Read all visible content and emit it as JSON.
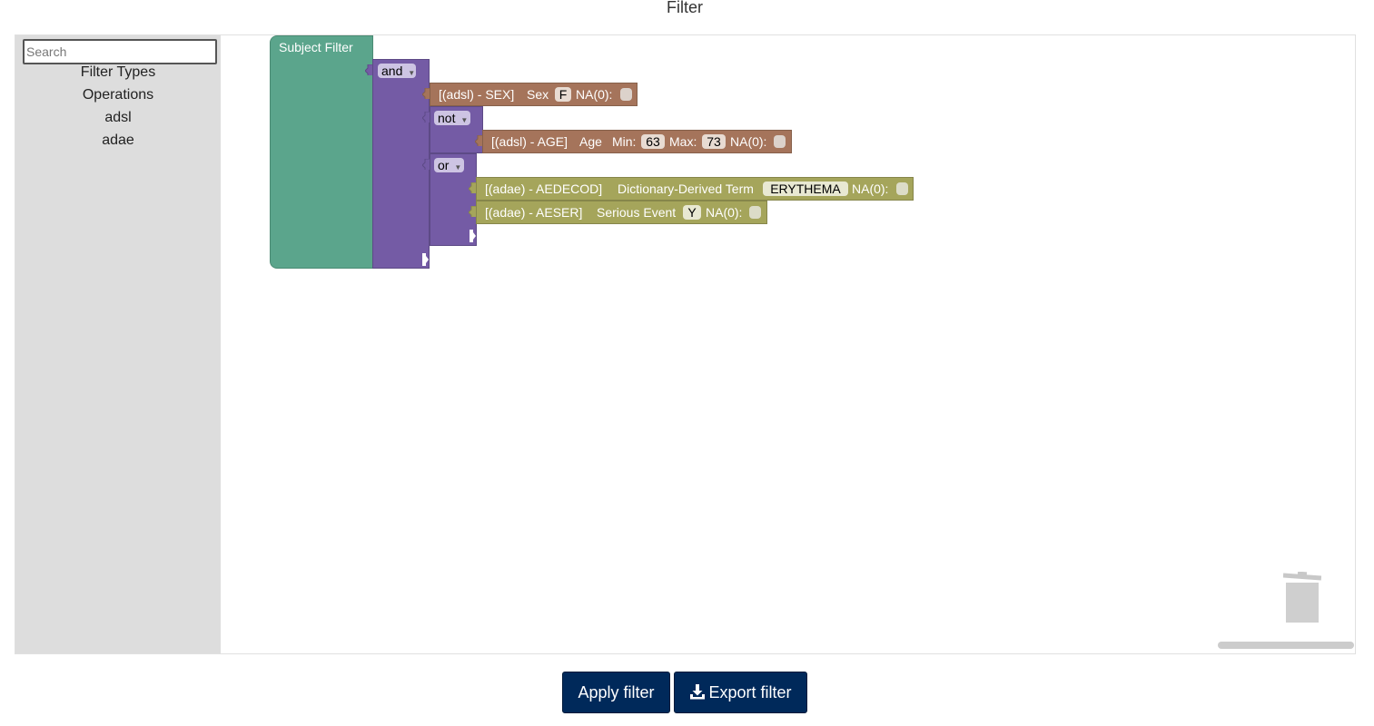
{
  "page": {
    "title": "Filter"
  },
  "toolbox": {
    "search_placeholder": "Search",
    "categories": [
      "Filter Types",
      "Operations",
      "adsl",
      "adae"
    ]
  },
  "blocks": {
    "root": {
      "label": "Subject Filter",
      "color": "#5ba58c"
    },
    "and_op": {
      "value": "and",
      "color": "#745ba5"
    },
    "sex_filter": {
      "label": "[(adsl) - SEX]",
      "name": "Sex",
      "value": "F",
      "na_label": "NA(0):",
      "color": "#a5745b"
    },
    "not_op": {
      "value": "not"
    },
    "age_filter": {
      "label": "[(adsl) - AGE]",
      "name": "Age",
      "min_label": "Min:",
      "min_value": "63",
      "max_label": "Max:",
      "max_value": "73",
      "na_label": "NA(0):"
    },
    "or_op": {
      "value": "or"
    },
    "aedecod_filter": {
      "label": "[(adae) - AEDECOD]",
      "name": "Dictionary-Derived Term",
      "value": "ERYTHEMA",
      "na_label": "NA(0):",
      "color": "#a5a55b"
    },
    "aeser_filter": {
      "label": "[(adae) - AESER]",
      "name": "Serious Event",
      "value": "Y",
      "na_label": "NA(0):"
    }
  },
  "actions": {
    "apply_label": "Apply filter",
    "export_label": "Export filter"
  },
  "icons": {
    "trash": "trash-icon",
    "download": "download-icon",
    "dropdown": "dropdown-arrow-icon"
  }
}
